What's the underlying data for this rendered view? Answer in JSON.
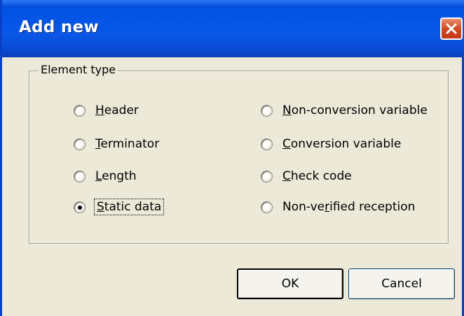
{
  "dialog": {
    "title": "Add new",
    "close_icon": "close-icon"
  },
  "group": {
    "label": "Element type"
  },
  "options": {
    "left": [
      {
        "pre": "",
        "acc": "H",
        "post": "eader",
        "selected": false
      },
      {
        "pre": "",
        "acc": "T",
        "post": "erminator",
        "selected": false
      },
      {
        "pre": "",
        "acc": "L",
        "post": "ength",
        "selected": false
      },
      {
        "pre": "",
        "acc": "S",
        "post": "tatic data",
        "selected": true
      }
    ],
    "right": [
      {
        "pre": "",
        "acc": "N",
        "post": "on-conversion variable",
        "selected": false
      },
      {
        "pre": "",
        "acc": "C",
        "post": "onversion variable",
        "selected": false
      },
      {
        "pre": "",
        "acc": "C",
        "post": "heck code",
        "selected": false
      },
      {
        "pre": "Non-ve",
        "acc": "r",
        "post": "ified reception",
        "selected": false
      }
    ]
  },
  "buttons": {
    "ok": "OK",
    "cancel": "Cancel"
  },
  "colors": {
    "title_bar": "#0053e3",
    "close_button": "#d14a24",
    "dialog_bg": "#ece9d8"
  }
}
